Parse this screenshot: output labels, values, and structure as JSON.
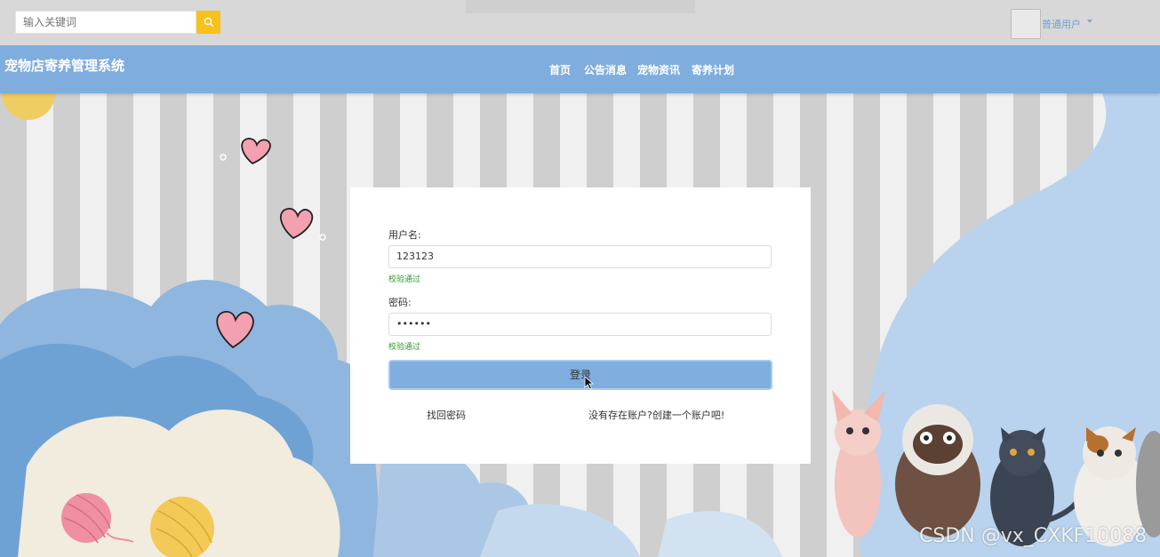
{
  "header": {
    "search": {
      "placeholder": "输入关键词"
    },
    "user_label": "普通用户"
  },
  "nav": {
    "site_title": "宠物店寄养管理系统",
    "items": [
      "首页",
      "公告消息",
      "宠物资讯",
      "寄养计划"
    ]
  },
  "login": {
    "username_label": "用户名:",
    "username_value": "123123",
    "username_status": "校验通过",
    "password_label": "密码:",
    "password_value": "••••••",
    "password_status": "校验通过",
    "submit_label": "登录",
    "forgot_link": "找回密码",
    "register_link": "没有存在账户?创建一个账户吧!"
  },
  "watermark": "CSDN @vx_CXKF10088",
  "colors": {
    "nav": "#7fadde",
    "search_button": "#f8c21c",
    "success": "#2f9a2f"
  }
}
